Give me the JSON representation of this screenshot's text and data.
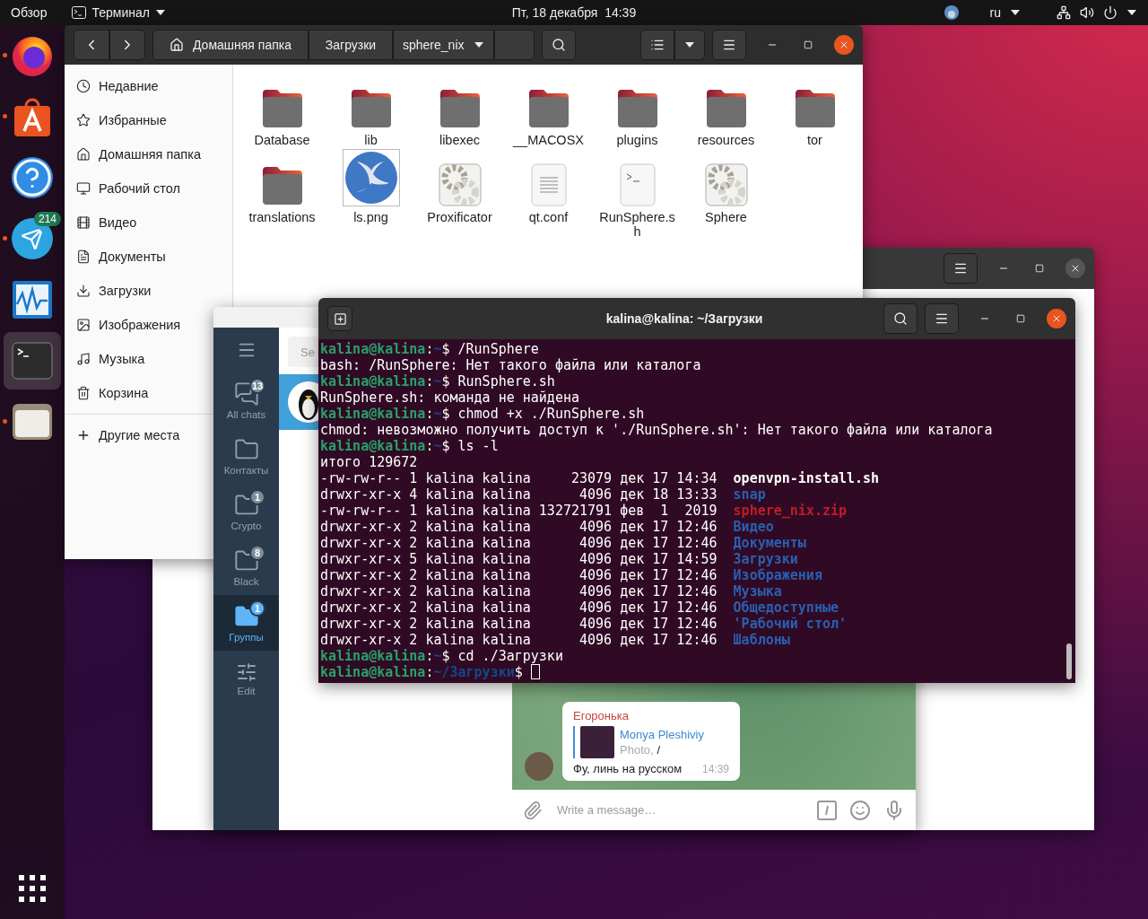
{
  "top_bar": {
    "activities": "Обзор",
    "app_menu": "Терминал",
    "clock": "Пт, 18 декабря  14:39",
    "keyboard_layout": "ru"
  },
  "dock": {
    "items": [
      {
        "kind": "browser",
        "running": true,
        "selected": false
      },
      {
        "kind": "store",
        "running": true,
        "selected": false
      },
      {
        "kind": "help",
        "running": false,
        "selected": false
      },
      {
        "kind": "messenger",
        "running": true,
        "selected": false,
        "badge": "214"
      },
      {
        "kind": "monitor",
        "running": false,
        "selected": false
      },
      {
        "kind": "terminal",
        "running": false,
        "selected": true
      },
      {
        "kind": "files",
        "running": true,
        "selected": false
      }
    ]
  },
  "file_manager": {
    "path": [
      "Домашняя папка",
      "Загрузки",
      "sphere_nix"
    ],
    "sidebar": [
      "Недавние",
      "Избранные",
      "Домашняя папка",
      "Рабочий стол",
      "Видео",
      "Документы",
      "Загрузки",
      "Изображения",
      "Музыка",
      "Корзина"
    ],
    "other_places": "Другие места",
    "items": [
      {
        "name": "Database",
        "kind": "folder"
      },
      {
        "name": "lib",
        "kind": "folder"
      },
      {
        "name": "libexec",
        "kind": "folder"
      },
      {
        "name": "__MACOSX",
        "kind": "folder"
      },
      {
        "name": "plugins",
        "kind": "folder"
      },
      {
        "name": "resources",
        "kind": "folder"
      },
      {
        "name": "tor",
        "kind": "folder"
      },
      {
        "name": "translations",
        "kind": "folder"
      },
      {
        "name": "ls.png",
        "kind": "image"
      },
      {
        "name": "Proxificator",
        "kind": "app"
      },
      {
        "name": "qt.conf",
        "kind": "text"
      },
      {
        "name": "RunSphere.sh",
        "kind": "script"
      },
      {
        "name": "Sphere",
        "kind": "app"
      }
    ]
  },
  "telegram": {
    "folders": [
      {
        "label": "All chats",
        "badge": "13",
        "kind": "all",
        "selected": false
      },
      {
        "label": "Контакты",
        "kind": "folder",
        "selected": false
      },
      {
        "label": "Crypto",
        "badge": "1",
        "kind": "folder",
        "selected": false
      },
      {
        "label": "Black",
        "badge": "8",
        "kind": "folder",
        "selected": false
      },
      {
        "label": "Группы",
        "badge": "1",
        "kind": "folder",
        "selected": true
      },
      {
        "label": "Edit",
        "kind": "edit",
        "selected": false
      }
    ],
    "search": {
      "placeholder": "Se"
    },
    "chats": [
      {
        "kind": "photo",
        "selected": true
      }
    ],
    "message": {
      "sender": "Егоронька",
      "reply_author": "Monya Pleshiviy",
      "reply_type": "Photo,",
      "reply_text": "/",
      "text": "Фу, линь на русском",
      "time": "14:39"
    },
    "composer": {
      "placeholder": "Write a message…"
    }
  },
  "terminal": {
    "title": "kalina@kalina: ~/Загрузки",
    "lines": [
      {
        "kind": "prompt",
        "user": "kalina@kalina",
        "sep": ":",
        "path": "~",
        "symbol": "$",
        "command": " /RunSphere",
        "cursor": false
      },
      {
        "kind": "output",
        "text": "bash: /RunSphere: Нет такого файла или каталога"
      },
      {
        "kind": "prompt",
        "user": "kalina@kalina",
        "sep": ":",
        "path": "~",
        "symbol": "$",
        "command": " RunSphere.sh",
        "cursor": false
      },
      {
        "kind": "output",
        "text": "RunSphere.sh: команда не найдена"
      },
      {
        "kind": "prompt",
        "user": "kalina@kalina",
        "sep": ":",
        "path": "~",
        "symbol": "$",
        "command": " chmod +x ./RunSphere.sh",
        "cursor": false
      },
      {
        "kind": "output",
        "text": "chmod: невозможно получить доступ к './RunSphere.sh': Нет такого файла или каталога"
      },
      {
        "kind": "prompt",
        "user": "kalina@kalina",
        "sep": ":",
        "path": "~",
        "symbol": "$",
        "command": " ls -l",
        "cursor": false
      },
      {
        "kind": "output",
        "text": "итого 129672"
      },
      {
        "kind": "file",
        "meta": "-rw-rw-r-- 1 kalina kalina     23079 дек 17 14:34",
        "name": "openvpn-install.sh",
        "color": "#ffffff"
      },
      {
        "kind": "file",
        "meta": "drwxr-xr-x 4 kalina kalina      4096 дек 18 13:33",
        "name": "snap",
        "color": "#2a5fb0"
      },
      {
        "kind": "file",
        "meta": "-rw-rw-r-- 1 kalina kalina 132721791 фев  1  2019",
        "name": "sphere_nix.zip",
        "color": "#c01c28"
      },
      {
        "kind": "file",
        "meta": "drwxr-xr-x 2 kalina kalina      4096 дек 17 12:46",
        "name": "Видео",
        "color": "#2a5fb0"
      },
      {
        "kind": "file",
        "meta": "drwxr-xr-x 2 kalina kalina      4096 дек 17 12:46",
        "name": "Документы",
        "color": "#2a5fb0"
      },
      {
        "kind": "file",
        "meta": "drwxr-xr-x 5 kalina kalina      4096 дек 17 14:59",
        "name": "Загрузки",
        "color": "#2a5fb0"
      },
      {
        "kind": "file",
        "meta": "drwxr-xr-x 2 kalina kalina      4096 дек 17 12:46",
        "name": "Изображения",
        "color": "#2a5fb0"
      },
      {
        "kind": "file",
        "meta": "drwxr-xr-x 2 kalina kalina      4096 дек 17 12:46",
        "name": "Музыка",
        "color": "#2a5fb0"
      },
      {
        "kind": "file",
        "meta": "drwxr-xr-x 2 kalina kalina      4096 дек 17 12:46",
        "name": "Общедоступные",
        "color": "#2a5fb0"
      },
      {
        "kind": "file",
        "meta": "drwxr-xr-x 2 kalina kalina      4096 дек 17 12:46",
        "name": "'Рабочий стол'",
        "color": "#2a5fb0"
      },
      {
        "kind": "file",
        "meta": "drwxr-xr-x 2 kalina kalina      4096 дек 17 12:46",
        "name": "Шаблоны",
        "color": "#2a5fb0"
      },
      {
        "kind": "prompt",
        "user": "kalina@kalina",
        "sep": ":",
        "path": "~",
        "symbol": "$",
        "command": " cd ./Загрузки",
        "cursor": false
      },
      {
        "kind": "prompt",
        "user": "kalina@kalina",
        "sep": ":",
        "path": "~/Загрузки",
        "symbol": "$",
        "cursor": true
      }
    ]
  }
}
